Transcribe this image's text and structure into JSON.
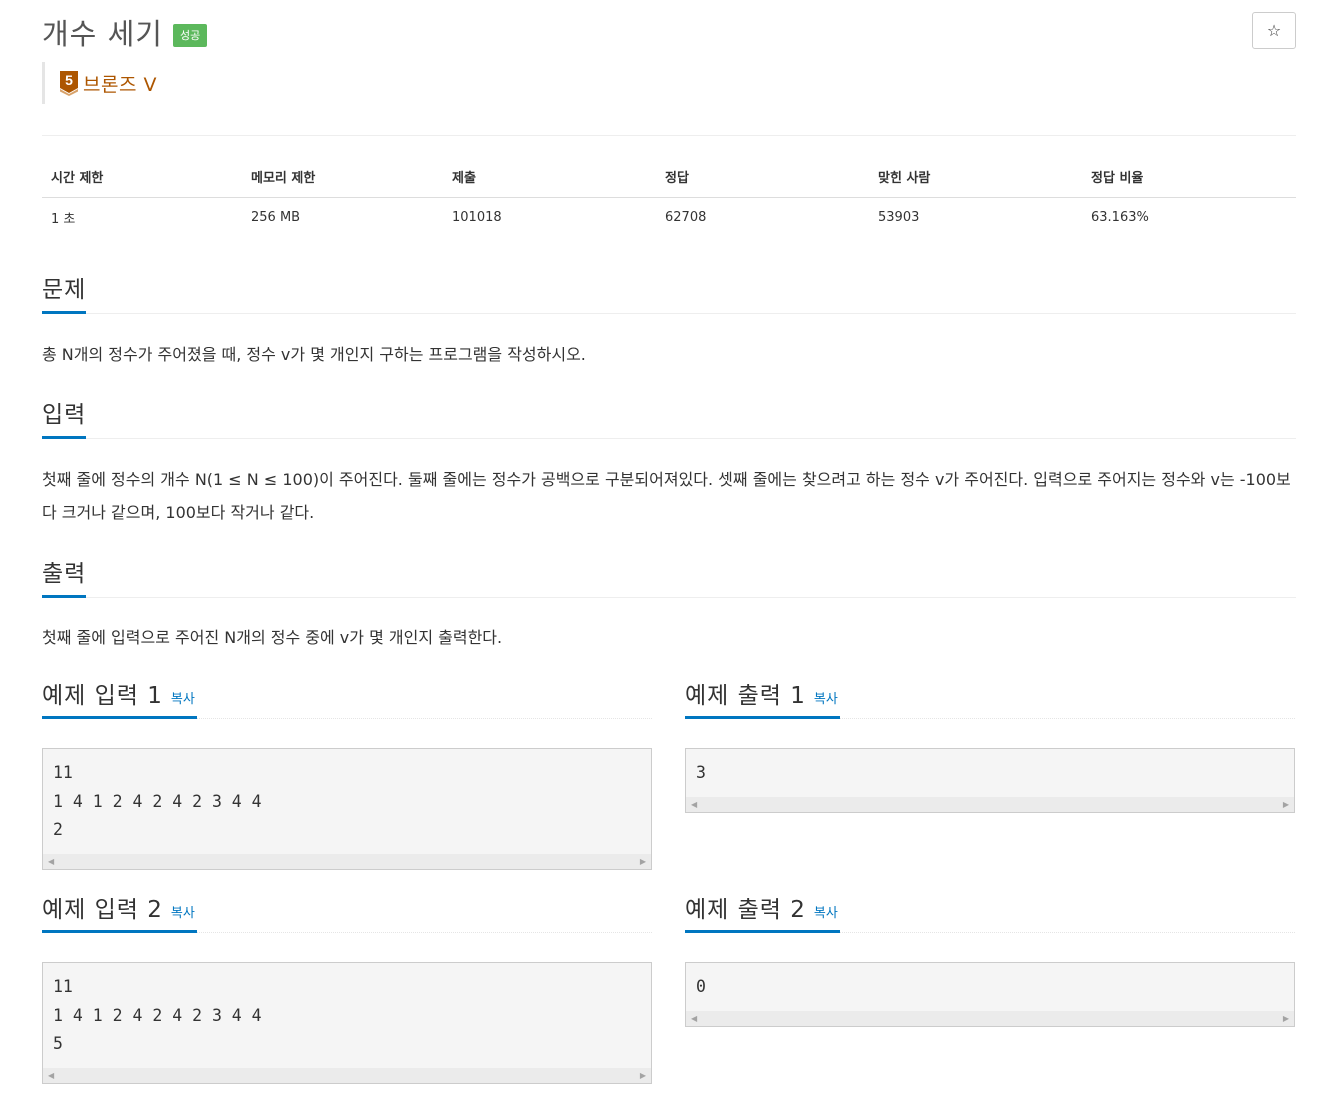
{
  "problem": {
    "title": "개수 세기",
    "status_badge": "성공",
    "star_icon": "☆",
    "tier": {
      "number": "5",
      "label": "브론즈 V",
      "color": "#ad5600"
    }
  },
  "info_table": {
    "headers": [
      "시간 제한",
      "메모리 제한",
      "제출",
      "정답",
      "맞힌 사람",
      "정답 비율"
    ],
    "values": [
      "1 초",
      "256 MB",
      "101018",
      "62708",
      "53903",
      "63.163%"
    ]
  },
  "sections": {
    "problem": {
      "title": "문제",
      "text": "총 N개의 정수가 주어졌을 때, 정수 v가 몇 개인지 구하는 프로그램을 작성하시오."
    },
    "input": {
      "title": "입력",
      "text": "첫째 줄에 정수의 개수 N(1 ≤ N ≤ 100)이 주어진다. 둘째 줄에는 정수가 공백으로 구분되어져있다. 셋째 줄에는 찾으려고 하는 정수 v가 주어진다. 입력으로 주어지는 정수와 v는 -100보다 크거나 같으며, 100보다 작거나 같다."
    },
    "output": {
      "title": "출력",
      "text": "첫째 줄에 입력으로 주어진 N개의 정수 중에 v가 몇 개인지 출력한다."
    }
  },
  "samples": {
    "copy_label": "복사",
    "input1": {
      "title": "예제 입력 1",
      "content": "11\n1 4 1 2 4 2 4 2 3 4 4\n2"
    },
    "output1": {
      "title": "예제 출력 1",
      "content": "3"
    },
    "input2": {
      "title": "예제 입력 2",
      "content": "11\n1 4 1 2 4 2 4 2 3 4 4\n5"
    },
    "output2": {
      "title": "예제 출력 2",
      "content": "0"
    }
  },
  "colors": {
    "accent": "#0076c0",
    "success": "#5cb85c",
    "bronze": "#ad5600"
  }
}
